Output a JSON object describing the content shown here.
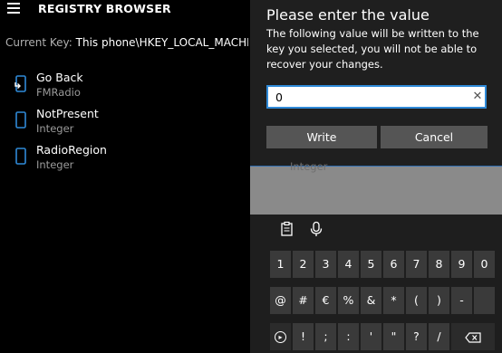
{
  "app": {
    "title": "REGISTRY BROWSER",
    "current_key_label": "Current Key:",
    "current_key_value": "This phone\\HKEY_LOCAL_MACHI..."
  },
  "items": [
    {
      "name": "Go Back",
      "type": "FMRadio",
      "icon": "folder-back-icon"
    },
    {
      "name": "NotPresent",
      "type": "Integer",
      "icon": "value-icon"
    },
    {
      "name": "RadioRegion",
      "type": "Integer",
      "icon": "value-icon"
    }
  ],
  "dialog": {
    "title": "Please enter the value",
    "message": "The following value will be written to the key you selected, you will not be able to recover your changes.",
    "input_value": "0",
    "write_label": "Write",
    "cancel_label": "Cancel"
  },
  "dimmed": {
    "ghost_text": "Integer"
  },
  "keyboard": {
    "tools": [
      "clipboard-icon",
      "microphone-icon"
    ],
    "row1": [
      "1",
      "2",
      "3",
      "4",
      "5",
      "6",
      "7",
      "8",
      "9",
      "0"
    ],
    "row2": [
      "@",
      "#",
      "€",
      "%",
      "&",
      "*",
      "(",
      ")",
      "-",
      ""
    ],
    "row3": [
      "!",
      ";",
      ":",
      "'",
      "\"",
      "?",
      "/"
    ]
  },
  "colors": {
    "accent": "#2f8ad8",
    "dialog_bg": "#1f1f1f",
    "key_bg": "#3a3a3a"
  }
}
